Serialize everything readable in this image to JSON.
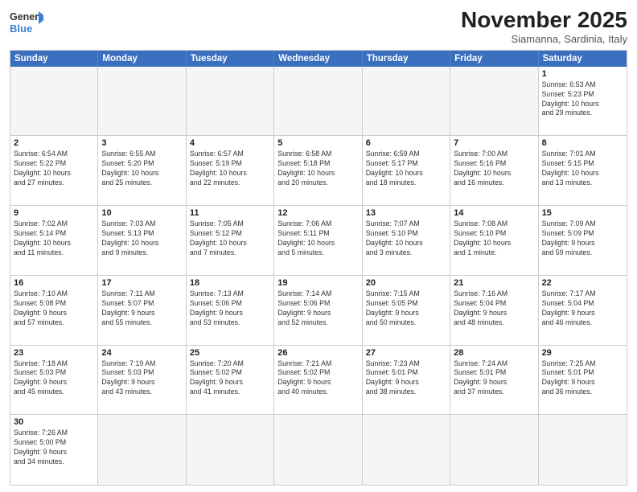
{
  "header": {
    "logo_general": "General",
    "logo_blue": "Blue",
    "month_title": "November 2025",
    "subtitle": "Siamanna, Sardinia, Italy"
  },
  "calendar": {
    "days_of_week": [
      "Sunday",
      "Monday",
      "Tuesday",
      "Wednesday",
      "Thursday",
      "Friday",
      "Saturday"
    ],
    "weeks": [
      [
        {
          "day": "",
          "info": "",
          "empty": true
        },
        {
          "day": "",
          "info": "",
          "empty": true
        },
        {
          "day": "",
          "info": "",
          "empty": true
        },
        {
          "day": "",
          "info": "",
          "empty": true
        },
        {
          "day": "",
          "info": "",
          "empty": true
        },
        {
          "day": "",
          "info": "",
          "empty": true
        },
        {
          "day": "1",
          "info": "Sunrise: 6:53 AM\nSunset: 5:23 PM\nDaylight: 10 hours\nand 29 minutes."
        }
      ],
      [
        {
          "day": "2",
          "info": "Sunrise: 6:54 AM\nSunset: 5:22 PM\nDaylight: 10 hours\nand 27 minutes."
        },
        {
          "day": "3",
          "info": "Sunrise: 6:55 AM\nSunset: 5:20 PM\nDaylight: 10 hours\nand 25 minutes."
        },
        {
          "day": "4",
          "info": "Sunrise: 6:57 AM\nSunset: 5:19 PM\nDaylight: 10 hours\nand 22 minutes."
        },
        {
          "day": "5",
          "info": "Sunrise: 6:58 AM\nSunset: 5:18 PM\nDaylight: 10 hours\nand 20 minutes."
        },
        {
          "day": "6",
          "info": "Sunrise: 6:59 AM\nSunset: 5:17 PM\nDaylight: 10 hours\nand 18 minutes."
        },
        {
          "day": "7",
          "info": "Sunrise: 7:00 AM\nSunset: 5:16 PM\nDaylight: 10 hours\nand 16 minutes."
        },
        {
          "day": "8",
          "info": "Sunrise: 7:01 AM\nSunset: 5:15 PM\nDaylight: 10 hours\nand 13 minutes."
        }
      ],
      [
        {
          "day": "9",
          "info": "Sunrise: 7:02 AM\nSunset: 5:14 PM\nDaylight: 10 hours\nand 11 minutes."
        },
        {
          "day": "10",
          "info": "Sunrise: 7:03 AM\nSunset: 5:13 PM\nDaylight: 10 hours\nand 9 minutes."
        },
        {
          "day": "11",
          "info": "Sunrise: 7:05 AM\nSunset: 5:12 PM\nDaylight: 10 hours\nand 7 minutes."
        },
        {
          "day": "12",
          "info": "Sunrise: 7:06 AM\nSunset: 5:11 PM\nDaylight: 10 hours\nand 5 minutes."
        },
        {
          "day": "13",
          "info": "Sunrise: 7:07 AM\nSunset: 5:10 PM\nDaylight: 10 hours\nand 3 minutes."
        },
        {
          "day": "14",
          "info": "Sunrise: 7:08 AM\nSunset: 5:10 PM\nDaylight: 10 hours\nand 1 minute."
        },
        {
          "day": "15",
          "info": "Sunrise: 7:09 AM\nSunset: 5:09 PM\nDaylight: 9 hours\nand 59 minutes."
        }
      ],
      [
        {
          "day": "16",
          "info": "Sunrise: 7:10 AM\nSunset: 5:08 PM\nDaylight: 9 hours\nand 57 minutes."
        },
        {
          "day": "17",
          "info": "Sunrise: 7:11 AM\nSunset: 5:07 PM\nDaylight: 9 hours\nand 55 minutes."
        },
        {
          "day": "18",
          "info": "Sunrise: 7:13 AM\nSunset: 5:06 PM\nDaylight: 9 hours\nand 53 minutes."
        },
        {
          "day": "19",
          "info": "Sunrise: 7:14 AM\nSunset: 5:06 PM\nDaylight: 9 hours\nand 52 minutes."
        },
        {
          "day": "20",
          "info": "Sunrise: 7:15 AM\nSunset: 5:05 PM\nDaylight: 9 hours\nand 50 minutes."
        },
        {
          "day": "21",
          "info": "Sunrise: 7:16 AM\nSunset: 5:04 PM\nDaylight: 9 hours\nand 48 minutes."
        },
        {
          "day": "22",
          "info": "Sunrise: 7:17 AM\nSunset: 5:04 PM\nDaylight: 9 hours\nand 46 minutes."
        }
      ],
      [
        {
          "day": "23",
          "info": "Sunrise: 7:18 AM\nSunset: 5:03 PM\nDaylight: 9 hours\nand 45 minutes."
        },
        {
          "day": "24",
          "info": "Sunrise: 7:19 AM\nSunset: 5:03 PM\nDaylight: 9 hours\nand 43 minutes."
        },
        {
          "day": "25",
          "info": "Sunrise: 7:20 AM\nSunset: 5:02 PM\nDaylight: 9 hours\nand 41 minutes."
        },
        {
          "day": "26",
          "info": "Sunrise: 7:21 AM\nSunset: 5:02 PM\nDaylight: 9 hours\nand 40 minutes."
        },
        {
          "day": "27",
          "info": "Sunrise: 7:23 AM\nSunset: 5:01 PM\nDaylight: 9 hours\nand 38 minutes."
        },
        {
          "day": "28",
          "info": "Sunrise: 7:24 AM\nSunset: 5:01 PM\nDaylight: 9 hours\nand 37 minutes."
        },
        {
          "day": "29",
          "info": "Sunrise: 7:25 AM\nSunset: 5:01 PM\nDaylight: 9 hours\nand 36 minutes."
        }
      ],
      [
        {
          "day": "30",
          "info": "Sunrise: 7:26 AM\nSunset: 5:00 PM\nDaylight: 9 hours\nand 34 minutes."
        },
        {
          "day": "",
          "info": "",
          "empty": true
        },
        {
          "day": "",
          "info": "",
          "empty": true
        },
        {
          "day": "",
          "info": "",
          "empty": true
        },
        {
          "day": "",
          "info": "",
          "empty": true
        },
        {
          "day": "",
          "info": "",
          "empty": true
        },
        {
          "day": "",
          "info": "",
          "empty": true
        }
      ]
    ]
  }
}
